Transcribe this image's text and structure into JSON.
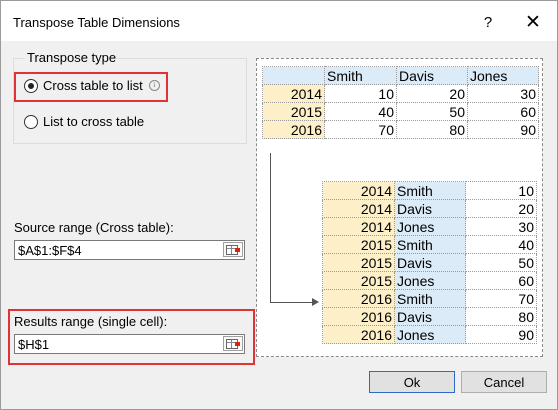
{
  "dialog": {
    "title": "Transpose Table Dimensions",
    "help_glyph": "?",
    "close_glyph": "✕"
  },
  "transpose_type": {
    "label": "Transpose type",
    "options": [
      {
        "label": "Cross table to list",
        "selected": true,
        "info_glyph": "i"
      },
      {
        "label": "List to cross table",
        "selected": false
      }
    ]
  },
  "source": {
    "label": "Source range (Cross table):",
    "value": "$A$1:$F$4"
  },
  "results": {
    "label": "Results range (single cell):",
    "value": "$H$1"
  },
  "preview": {
    "cross_table": {
      "headers": [
        "",
        "Smith",
        "Davis",
        "Jones"
      ],
      "rows": [
        [
          "2014",
          "10",
          "20",
          "30"
        ],
        [
          "2015",
          "40",
          "50",
          "60"
        ],
        [
          "2016",
          "70",
          "80",
          "90"
        ]
      ]
    },
    "list": [
      [
        "2014",
        "Smith",
        "10"
      ],
      [
        "2014",
        "Davis",
        "20"
      ],
      [
        "2014",
        "Jones",
        "30"
      ],
      [
        "2015",
        "Smith",
        "40"
      ],
      [
        "2015",
        "Davis",
        "50"
      ],
      [
        "2015",
        "Jones",
        "60"
      ],
      [
        "2016",
        "Smith",
        "70"
      ],
      [
        "2016",
        "Davis",
        "80"
      ],
      [
        "2016",
        "Jones",
        "90"
      ]
    ]
  },
  "buttons": {
    "ok": "Ok",
    "cancel": "Cancel"
  },
  "colors": {
    "highlight": "#e03434",
    "year_fill": "#fdf0c8",
    "name_fill": "#dcebf8",
    "default_button_border": "#2a6cc6"
  }
}
